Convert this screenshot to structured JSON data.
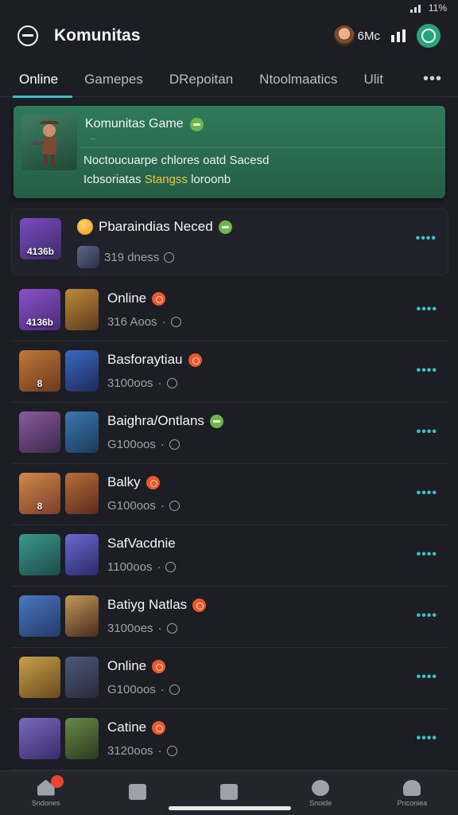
{
  "status_bar": {
    "battery_text": "11%"
  },
  "header": {
    "title": "Komunitas",
    "user_label": "6Mc"
  },
  "tabs": [
    {
      "label": "Online",
      "active": true
    },
    {
      "label": "Gamepes",
      "active": false
    },
    {
      "label": "DRepoitan",
      "active": false
    },
    {
      "label": "Ntoolmaatics",
      "active": false
    },
    {
      "label": "Ulit",
      "active": false
    }
  ],
  "featured": {
    "title": "Komunitas Game",
    "subtitle": "...",
    "line1": "Noctoucuarpe chlores oatd Sacesd",
    "line2_prefix": "Icbsoriatas",
    "line2_highlight": "Stangss",
    "line2_suffix": "loroonb"
  },
  "rows": [
    {
      "name": "Pbaraindias Neced",
      "meta": "319 dness",
      "img_label": "4136b",
      "badge": "green"
    },
    {
      "name": "Online",
      "meta": "316 Aoos",
      "img_label": "4136b",
      "badge": "orange"
    },
    {
      "name": "Basforaytiau",
      "meta": "3100oos",
      "img_label": "8",
      "badge": "orange"
    },
    {
      "name": "Baighra/Ontlans",
      "meta": "G100oos",
      "img_label": "",
      "badge": "green"
    },
    {
      "name": "Balky",
      "meta": "G100oos",
      "img_label": "8",
      "badge": "orange"
    },
    {
      "name": "SafVacdnie",
      "meta": "1100oos",
      "img_label": "",
      "badge": "none"
    },
    {
      "name": "Batiyg Natlas",
      "meta": "3100oes",
      "img_label": "",
      "badge": "orange"
    },
    {
      "name": "Online",
      "meta": "G100oos",
      "img_label": "",
      "badge": "orange"
    },
    {
      "name": "Catine",
      "meta": "3120oos",
      "img_label": "",
      "badge": "orange"
    }
  ],
  "bottom_nav": [
    {
      "label": "Sndones"
    },
    {
      "label": ""
    },
    {
      "label": ""
    },
    {
      "label": "Snoide"
    },
    {
      "label": "Pnconiea"
    }
  ],
  "colors": {
    "accent": "#35c3c8",
    "featured_bg": "#2f7a5b",
    "badge_green": "#6ab84a",
    "badge_orange": "#e8592e"
  }
}
